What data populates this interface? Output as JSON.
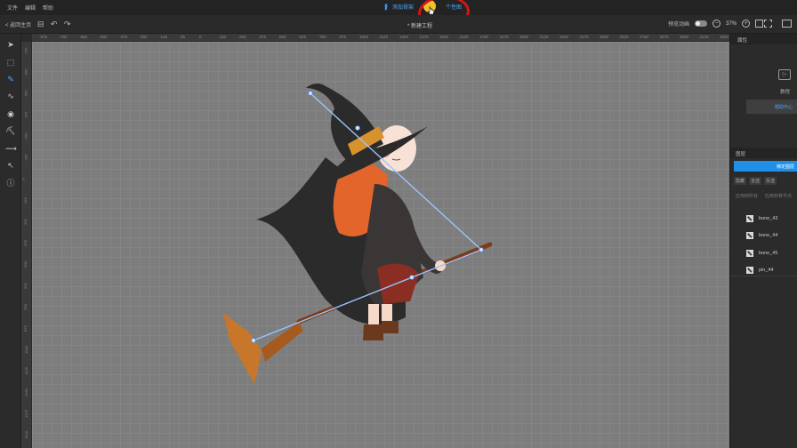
{
  "menu": [
    "文件",
    "编辑",
    "帮助"
  ],
  "top_tabs": [
    {
      "label": "添加骨架"
    },
    {
      "label": "个性图"
    }
  ],
  "toolbar": {
    "back_label": "< 返回主页",
    "doc_title": "* 新建工程",
    "toggle_label": "预览动画",
    "zoom": "37%"
  },
  "ruler_top": [
    "-875",
    "-760",
    "-665",
    "-560",
    "-370",
    "-260",
    "-125",
    "-35",
    "0",
    "150",
    "250",
    "375",
    "500",
    "625",
    "750",
    "875",
    "1000",
    "1120",
    "1250",
    "1375",
    "1500",
    "1625",
    "1750",
    "1875",
    "2000",
    "2125",
    "2250",
    "2375",
    "2500",
    "2625",
    "2750",
    "2875",
    "3000",
    "3125",
    "3250"
  ],
  "ruler_left": [
    "-725",
    "-605",
    "-500",
    "-375",
    "-250",
    "-125",
    "0",
    "125",
    "250",
    "375",
    "500",
    "625",
    "750",
    "875",
    "1000",
    "1125",
    "1250",
    "1375",
    "1500"
  ],
  "right_panel": {
    "header": "属性",
    "tutorial_label": "教程",
    "tutorial_button": "帮助中心"
  },
  "layers_panel": {
    "header": "图层",
    "primary_button": "绑定图层",
    "chips": [
      "隐藏",
      "全选",
      "反选"
    ],
    "links": [
      "应用到所有",
      "应用到骨节点"
    ],
    "items": [
      {
        "name": "bone_43"
      },
      {
        "name": "bone_44"
      },
      {
        "name": "bone_45"
      },
      {
        "name": "pin_44"
      }
    ]
  },
  "colors": {
    "accent": "#1e90e8",
    "highlight_ring": "#d0161b",
    "bone": "#8db7ff"
  }
}
